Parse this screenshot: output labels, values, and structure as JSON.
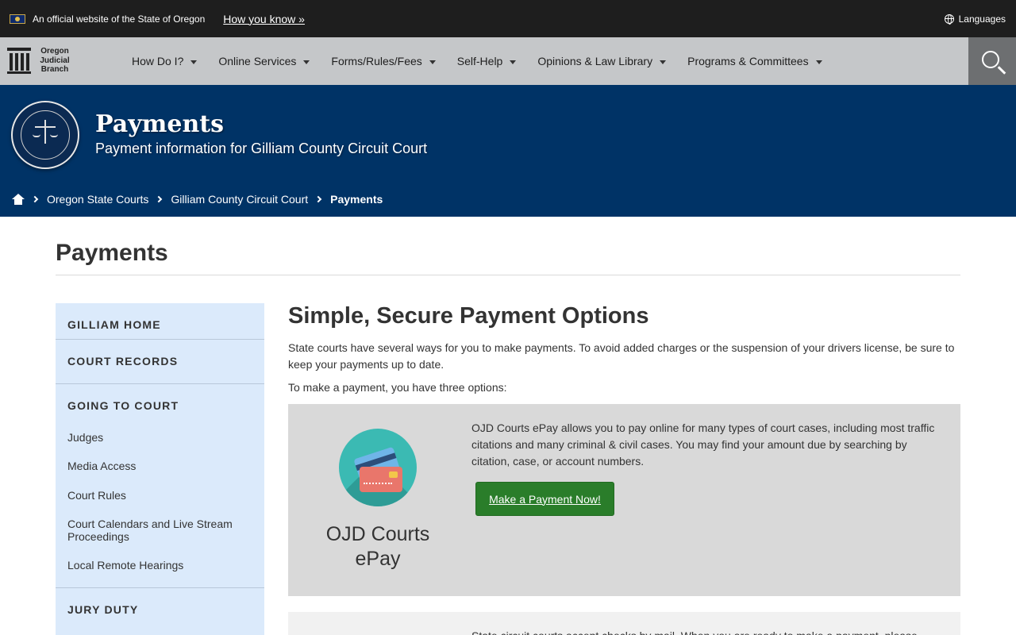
{
  "official": {
    "text": "An official website of the State of Oregon",
    "how_link": "How you know »",
    "languages": "Languages"
  },
  "logo": {
    "line1": "Oregon",
    "line2": "Judicial",
    "line3": "Branch"
  },
  "nav": {
    "items": [
      {
        "label": "How Do I?"
      },
      {
        "label": "Online Services"
      },
      {
        "label": "Forms/Rules/Fees"
      },
      {
        "label": "Self-Help"
      },
      {
        "label": "Opinions & Law Library"
      },
      {
        "label": "Programs & Committees"
      }
    ]
  },
  "hero": {
    "title": "Payments",
    "subtitle": "Payment information for Gilliam County Circuit Court"
  },
  "breadcrumb": {
    "items": [
      "Oregon State Courts",
      "Gilliam County Circuit Court"
    ],
    "current": "Payments"
  },
  "page": {
    "title": "Payments"
  },
  "sidebar": {
    "home": "GILLIAM HOME",
    "records": "COURT RECORDS",
    "going": "GOING TO COURT",
    "links": [
      "Judges",
      "Media Access",
      "Court Rules",
      "Court Calendars and Live Stream Proceedings",
      "Local Remote Hearings"
    ],
    "jury": "JURY DUTY"
  },
  "main": {
    "heading": "Simple, Secure Payment Options",
    "intro": "State courts have several ways for you to make payments. To avoid added charges or the suspension of your drivers license, be sure to keep your payments up to date.",
    "options_intro": "To make a payment, you have three options:",
    "epay": {
      "title": "OJD Courts ePay",
      "text": "OJD Courts ePay allows you to pay online for many types of court cases, including most traffic citations and many criminal & civil cases. You may find your amount due by searching by citation, case, or account numbers.",
      "button": "Make a Payment Now!"
    },
    "mail": {
      "text": "State circuit courts accept checks by mail. When you are ready to make a payment, please"
    }
  },
  "colors": {
    "banner": "#1e1e1e",
    "nav": "#c5c7c9",
    "hero": "#003366",
    "sidebar": "#dbeafb",
    "button": "#2a7d2a",
    "epay_circle": "#3bbab3"
  }
}
